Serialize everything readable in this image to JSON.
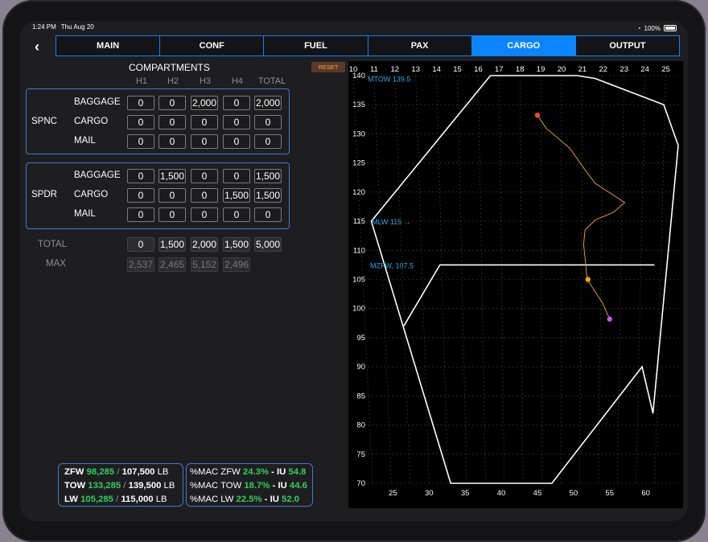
{
  "status_bar": {
    "time": "1:24 PM",
    "date": "Thu Aug 20",
    "battery": "100%"
  },
  "nav": {
    "back_icon": "chevron-left-icon"
  },
  "tabs": [
    {
      "label": "MAIN",
      "active": false
    },
    {
      "label": "CONF",
      "active": false
    },
    {
      "label": "FUEL",
      "active": false
    },
    {
      "label": "PAX",
      "active": false
    },
    {
      "label": "CARGO",
      "active": true
    },
    {
      "label": "OUTPUT",
      "active": false
    }
  ],
  "compartments": {
    "title": "COMPARTMENTS",
    "reset_label": "RESET",
    "columns": [
      "H1",
      "H2",
      "H3",
      "H4",
      "TOTAL"
    ],
    "groups": [
      {
        "name": "SPNC",
        "rows": [
          {
            "label": "BAGGAGE",
            "values": [
              "0",
              "0",
              "2,000",
              "0"
            ],
            "total": "2,000"
          },
          {
            "label": "CARGO",
            "values": [
              "0",
              "0",
              "0",
              "0"
            ],
            "total": "0"
          },
          {
            "label": "MAIL",
            "values": [
              "0",
              "0",
              "0",
              "0"
            ],
            "total": "0"
          }
        ]
      },
      {
        "name": "SPDR",
        "rows": [
          {
            "label": "BAGGAGE",
            "values": [
              "0",
              "1,500",
              "0",
              "0"
            ],
            "total": "1,500"
          },
          {
            "label": "CARGO",
            "values": [
              "0",
              "0",
              "0",
              "1,500"
            ],
            "total": "1,500"
          },
          {
            "label": "MAIL",
            "values": [
              "0",
              "0",
              "0",
              "0"
            ],
            "total": "0"
          }
        ]
      }
    ],
    "total_row": {
      "label": "TOTAL",
      "values": [
        "0",
        "1,500",
        "2,000",
        "1,500"
      ],
      "total": "5,000"
    },
    "max_row": {
      "label": "MAX",
      "values": [
        "2,537",
        "2,465",
        "5,152",
        "2,496"
      ]
    }
  },
  "weights": {
    "zfw": {
      "label": "ZFW",
      "value": "98,285",
      "sep": "/",
      "limit": "107,500",
      "unit": "LB"
    },
    "tow": {
      "label": "TOW",
      "value": "133,285",
      "sep": "/",
      "limit": "139,500",
      "unit": "LB"
    },
    "lw": {
      "label": "LW",
      "value": "105,285",
      "sep": "/",
      "limit": "115,000",
      "unit": "LB"
    }
  },
  "mac": {
    "zfw": {
      "prefix": "%MAC ZFW",
      "pct": "24.3%",
      "iu_label": "- IU",
      "iu": "54.8"
    },
    "tow": {
      "prefix": "%MAC TOW",
      "pct": "18.7%",
      "iu_label": "- IU",
      "iu": "44.6"
    },
    "lw": {
      "prefix": "%MAC LW",
      "pct": "22.5%",
      "iu_label": "- IU",
      "iu": "52.0"
    }
  },
  "chart_data": {
    "type": "line",
    "y_ticks": [
      "140",
      "135",
      "130",
      "125",
      "120",
      "115",
      "110",
      "105",
      "100",
      "95",
      "90",
      "85",
      "80",
      "75",
      "70"
    ],
    "ylim": [
      70,
      140
    ],
    "top_ticks": [
      "10",
      "11",
      "12",
      "13",
      "14",
      "15",
      "16",
      "17",
      "18",
      "19",
      "20",
      "21",
      "22",
      "23",
      "24",
      "25"
    ],
    "bottom_ticks": [
      "25",
      "30",
      "35",
      "40",
      "45",
      "50",
      "55",
      "60"
    ],
    "xlim_bottom": [
      21.5,
      64.5
    ],
    "limit_labels": [
      {
        "text": "MTOW 139.5",
        "y": 139.5
      },
      {
        "text": "MLW 115 →",
        "y": 115
      },
      {
        "text": "MZFW, 107.5",
        "y": 107.5
      }
    ],
    "envelope": [
      [
        38.5,
        140
      ],
      [
        50.5,
        140
      ],
      [
        53,
        139.5
      ],
      [
        62.5,
        135
      ],
      [
        64.5,
        128
      ],
      [
        61,
        82
      ],
      [
        59.5,
        90
      ],
      [
        47,
        70
      ],
      [
        33,
        70
      ],
      [
        22,
        115
      ],
      [
        38.5,
        140
      ]
    ],
    "zfw_box": [
      [
        26.5,
        97
      ],
      [
        31.5,
        107.5
      ],
      [
        61.2,
        107.5
      ]
    ],
    "cg_path": [
      [
        45,
        133.2
      ],
      [
        46.2,
        131
      ],
      [
        49.5,
        127.5
      ],
      [
        51.5,
        124
      ],
      [
        53,
        121.5
      ],
      [
        57.1,
        118.2
      ],
      [
        55.5,
        116.5
      ],
      [
        53,
        115.2
      ],
      [
        51.6,
        113.5
      ],
      [
        51.4,
        111
      ],
      [
        51.9,
        105
      ],
      [
        54,
        101
      ],
      [
        55,
        98.2
      ]
    ],
    "points": [
      {
        "name": "TOW",
        "x": 45,
        "y": 133.2,
        "color": "#ff453a"
      },
      {
        "name": "LW",
        "x": 52,
        "y": 105,
        "color": "#ff9f0a"
      },
      {
        "name": "ZFW",
        "x": 55,
        "y": 98.2,
        "color": "#bf5af2"
      }
    ],
    "grid": true
  }
}
